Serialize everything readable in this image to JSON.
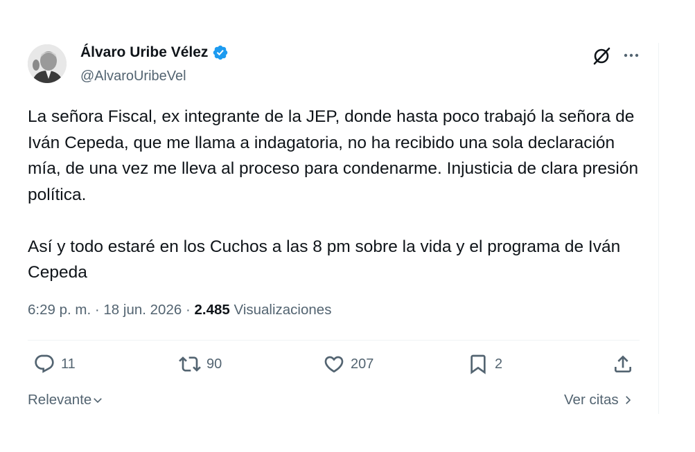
{
  "author": {
    "name": "Álvaro Uribe Vélez",
    "handle": "@AlvaroUribeVel",
    "verified": true,
    "avatar_icon": "portrait-avatar"
  },
  "header_icons": {
    "grok": "grok-icon",
    "more": "more-options-icon"
  },
  "tweet": {
    "paragraph1": "La señora Fiscal, ex integrante de la JEP, donde hasta poco trabajó la señora de Iván Cepeda, que me llama a indagatoria,  no ha recibido una sola declaración mía, de una vez me  lleva al proceso para condenarme. Injusticia de clara presión política.",
    "paragraph2": "Así y todo estaré en los Cuchos a las 8 pm sobre la vida y el programa de Iván Cepeda"
  },
  "meta": {
    "time": "6:29 p. m.",
    "date": "18 jun. 2026",
    "views_count": "2.485",
    "views_label": "Visualizaciones"
  },
  "actions": {
    "replies": "11",
    "retweets": "90",
    "likes": "207",
    "bookmarks": "2"
  },
  "footer": {
    "sort_label": "Relevante",
    "quotes_label": "Ver citas"
  },
  "colors": {
    "verified": "#1d9bf0",
    "secondary_text": "#536471",
    "primary_text": "#0f1419",
    "divider": "#eff3f4"
  }
}
